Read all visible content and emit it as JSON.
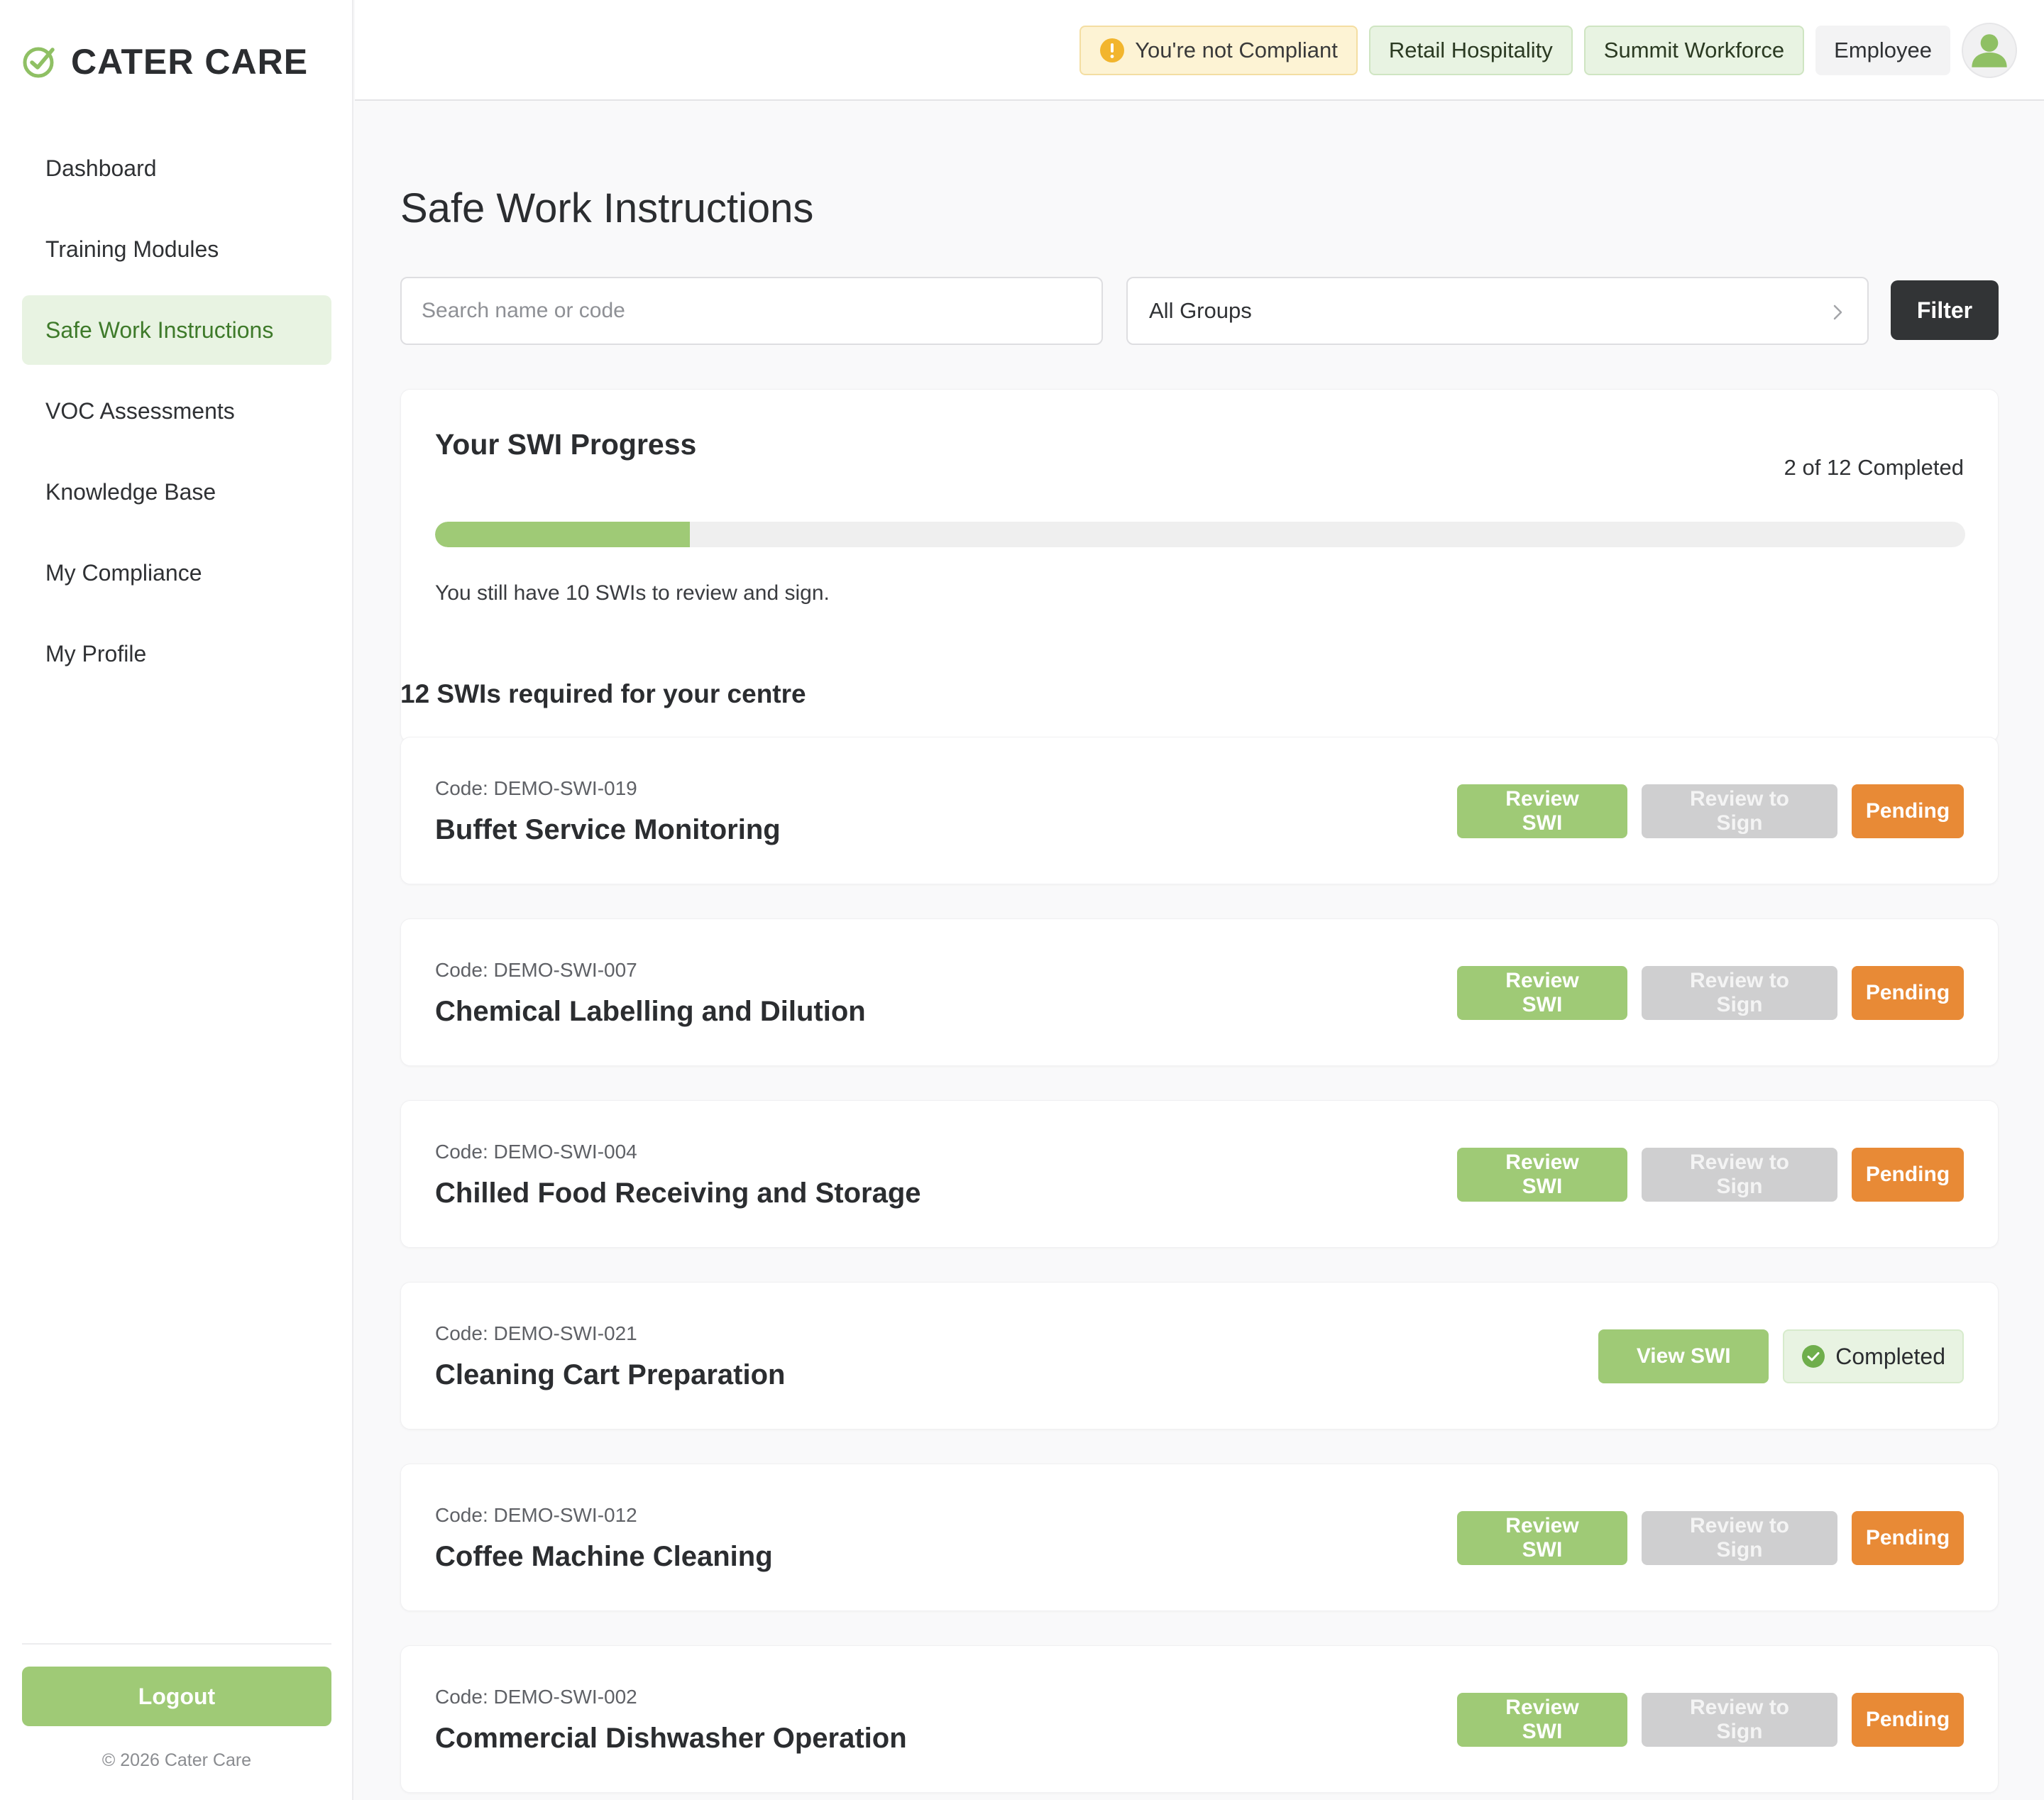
{
  "brand": {
    "name": "CATER CARE"
  },
  "sidebar": {
    "items": [
      {
        "label": "Dashboard",
        "active": false
      },
      {
        "label": "Training Modules",
        "active": false
      },
      {
        "label": "Safe Work Instructions",
        "active": true
      },
      {
        "label": "VOC Assessments",
        "active": false
      },
      {
        "label": "Knowledge Base",
        "active": false
      },
      {
        "label": "My Compliance",
        "active": false
      },
      {
        "label": "My Profile",
        "active": false
      }
    ],
    "logout_label": "Logout",
    "copyright": "© 2026 Cater Care"
  },
  "header": {
    "compliance_status": "You're not Compliant",
    "tags": [
      "Retail Hospitality",
      "Summit Workforce"
    ],
    "role": "Employee"
  },
  "page": {
    "title": "Safe Work Instructions",
    "search_placeholder": "Search name or code",
    "search_value": "",
    "group_select": "All Groups",
    "filter_label": "Filter"
  },
  "progress": {
    "title": "Your SWI Progress",
    "completed_text": "2 of 12 Completed",
    "completed": 2,
    "total": 12,
    "note": "You still have 10 SWIs to review and sign."
  },
  "list": {
    "heading": "12 SWIs required for your centre",
    "items": [
      {
        "code": "Code: DEMO-SWI-019",
        "title": "Buffet Service Monitoring",
        "status": "pending",
        "primary": "Review SWI",
        "secondary": "Review to Sign",
        "badge": "Pending"
      },
      {
        "code": "Code: DEMO-SWI-007",
        "title": "Chemical Labelling and Dilution",
        "status": "pending",
        "primary": "Review SWI",
        "secondary": "Review to Sign",
        "badge": "Pending"
      },
      {
        "code": "Code: DEMO-SWI-004",
        "title": "Chilled Food Receiving and Storage",
        "status": "pending",
        "primary": "Review SWI",
        "secondary": "Review to Sign",
        "badge": "Pending"
      },
      {
        "code": "Code: DEMO-SWI-021",
        "title": "Cleaning Cart Preparation",
        "status": "completed",
        "primary": "View SWI",
        "badge": "Completed"
      },
      {
        "code": "Code: DEMO-SWI-012",
        "title": "Coffee Machine Cleaning",
        "status": "pending",
        "primary": "Review SWI",
        "secondary": "Review to Sign",
        "badge": "Pending"
      },
      {
        "code": "Code: DEMO-SWI-002",
        "title": "Commercial Dishwasher Operation",
        "status": "pending",
        "primary": "Review SWI",
        "secondary": "Review to Sign",
        "badge": "Pending"
      }
    ]
  },
  "icons": {
    "brand": "check-circle-icon",
    "warning": "exclamation-circle-icon",
    "avatar": "user-avatar-icon",
    "chevron": "chevron-right-icon",
    "completed": "check-circle-icon"
  },
  "colors": {
    "accent": "#9fca76",
    "pending": "#e88a36",
    "disabled": "#cfcfd0",
    "active_nav_bg": "#e8f3e2",
    "filter_btn": "#323436"
  }
}
